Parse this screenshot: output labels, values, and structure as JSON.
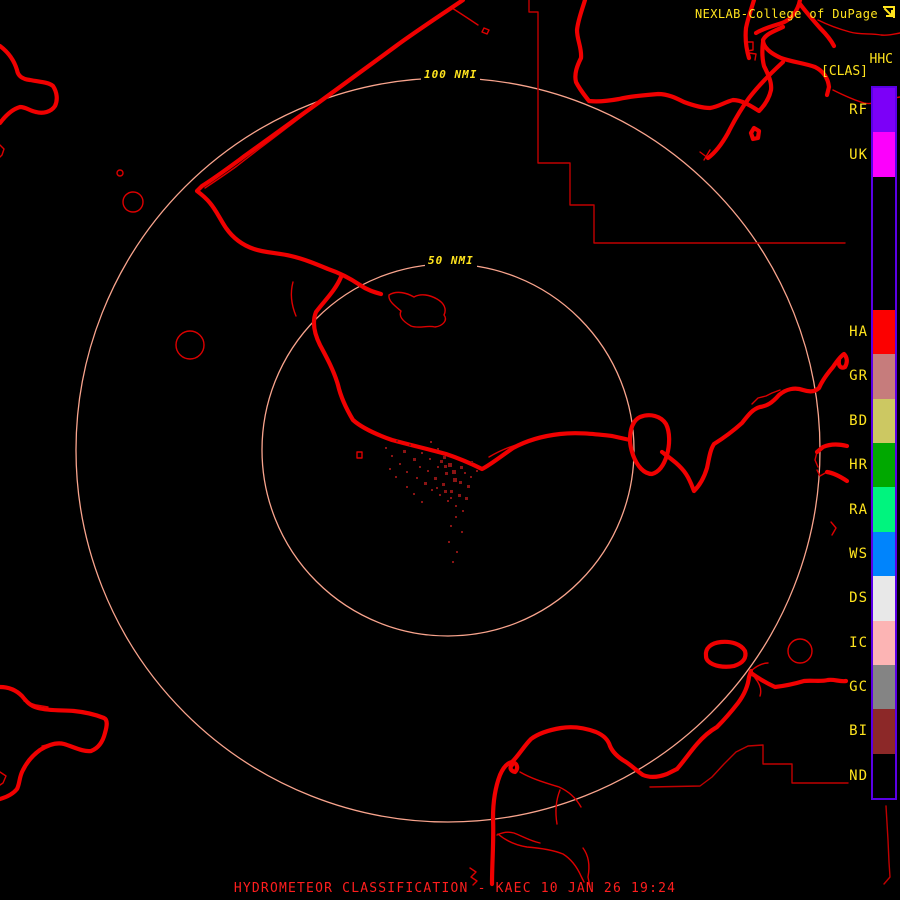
{
  "header": {
    "source": "NEXLAB-College of DuPage",
    "logo_icon": "corner-arrow-icon"
  },
  "product": {
    "code": "HHC",
    "tag": "[CLAS]"
  },
  "range_rings": {
    "outer_label": "100 NMI",
    "inner_label": "50 NMI"
  },
  "legend": {
    "entries": [
      {
        "label": "RF",
        "color": "#7C00F8",
        "span": 1
      },
      {
        "label": "UK",
        "color": "#FC00FC",
        "span": 1
      },
      {
        "label": "",
        "color": "#000000",
        "span": 3
      },
      {
        "label": "HA",
        "color": "#FC0000",
        "span": 1
      },
      {
        "label": "GR",
        "color": "#C67C7C",
        "span": 1
      },
      {
        "label": "BD",
        "color": "#CCC862",
        "span": 1
      },
      {
        "label": "HR",
        "color": "#00A800",
        "span": 1
      },
      {
        "label": "RA",
        "color": "#00F47E",
        "span": 1
      },
      {
        "label": "WS",
        "color": "#0084FC",
        "span": 1
      },
      {
        "label": "DS",
        "color": "#E8E8E8",
        "span": 1
      },
      {
        "label": "IC",
        "color": "#FCB4B4",
        "span": 1
      },
      {
        "label": "GC",
        "color": "#848484",
        "span": 1
      },
      {
        "label": "BI",
        "color": "#8C2828",
        "span": 1
      },
      {
        "label": "ND",
        "color": "#000000",
        "span": 1
      }
    ]
  },
  "footer": {
    "title": "HYDROMETEOR CLASSIFICATION - KAEC 10 JAN 26 19:24"
  },
  "colors": {
    "background": "#000000",
    "coast-red": "#F00000",
    "coast-thin-red": "#DC0000",
    "boundary-red": "#C00000",
    "speckle-red": "#8B1414",
    "ring-salmon": "#F9A48D",
    "label-yellow": "#FFE41E",
    "footer-red": "#FF1E1E",
    "legend-border": "#5A00E6"
  }
}
